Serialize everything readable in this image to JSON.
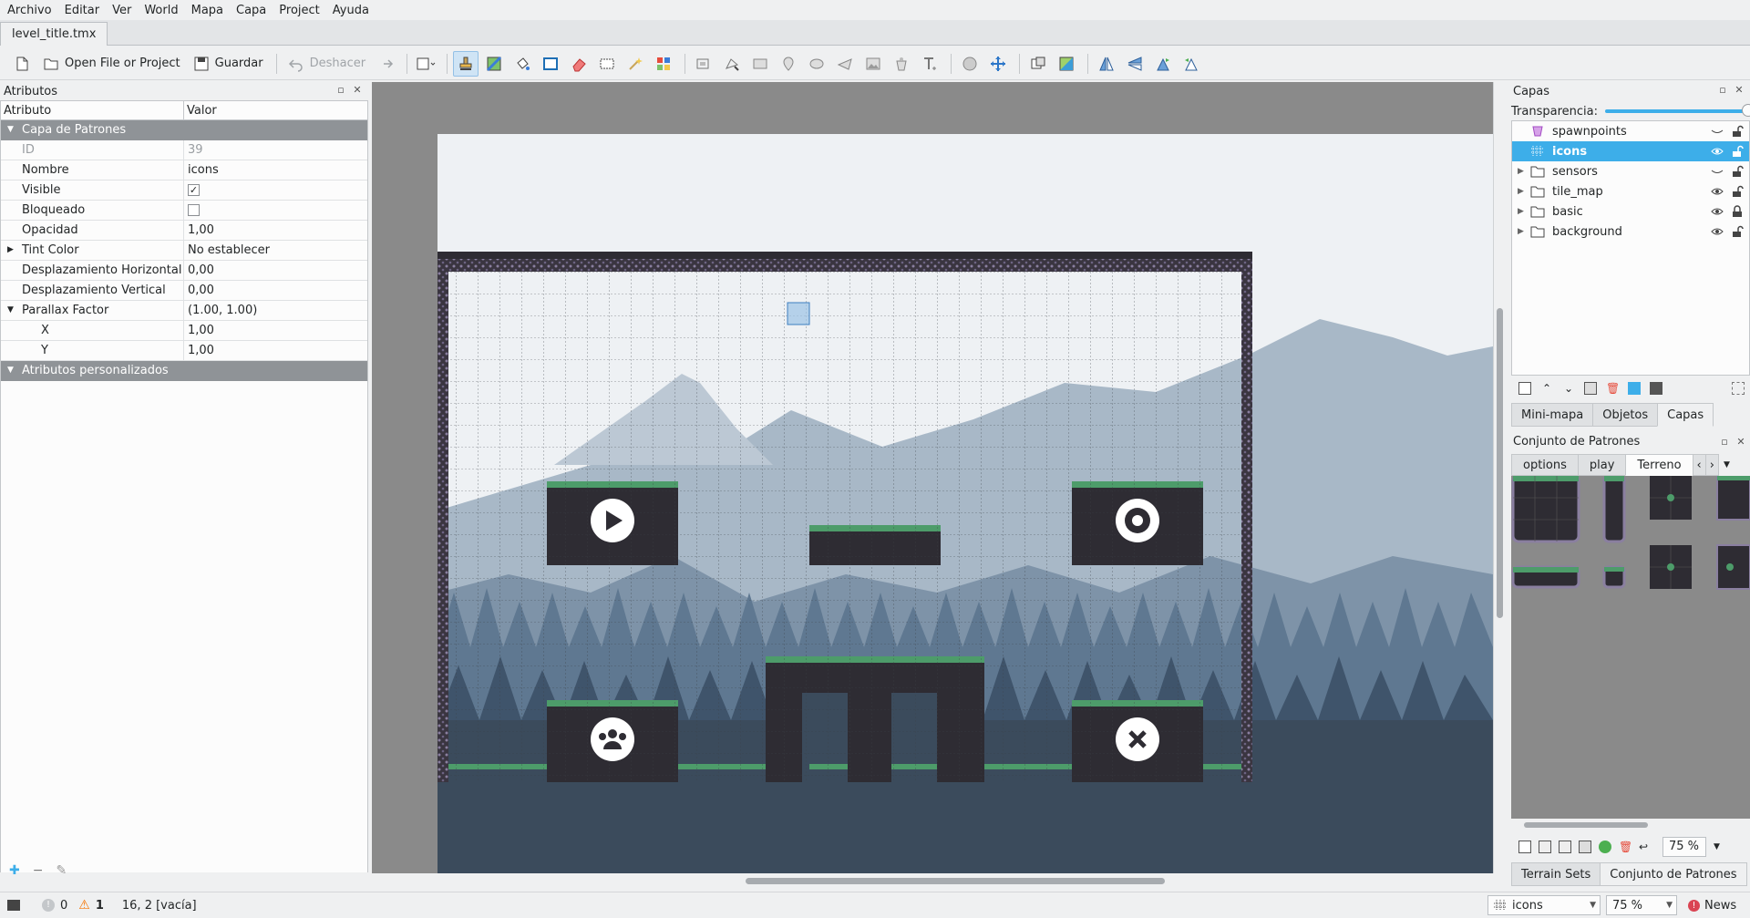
{
  "menu": [
    "Archivo",
    "Editar",
    "Ver",
    "World",
    "Mapa",
    "Capa",
    "Project",
    "Ayuda"
  ],
  "document_tab": "level_title.tmx",
  "toolbar": {
    "open_label": "Open File or Project",
    "save_label": "Guardar",
    "undo_label": "Deshacer"
  },
  "properties_panel": {
    "title": "Atributos",
    "col_attr": "Atributo",
    "col_value": "Valor",
    "group_layer": "Capa de Patrones",
    "rows": [
      {
        "k": "ID",
        "v": "39"
      },
      {
        "k": "Nombre",
        "v": "icons"
      },
      {
        "k": "Visible",
        "v": "checked"
      },
      {
        "k": "Bloqueado",
        "v": "unchecked"
      },
      {
        "k": "Opacidad",
        "v": "1,00"
      },
      {
        "k": "Tint Color",
        "v": "No establecer"
      },
      {
        "k": "Desplazamiento Horizontal",
        "v": "0,00"
      },
      {
        "k": "Desplazamiento Vertical",
        "v": "0,00"
      },
      {
        "k": "Parallax Factor",
        "v": "(1.00, 1.00)"
      },
      {
        "k": "X",
        "v": "1,00"
      },
      {
        "k": "Y",
        "v": "1,00"
      }
    ],
    "group_custom": "Atributos personalizados"
  },
  "layers_panel": {
    "title": "Capas",
    "transparency_label": "Transparencia:",
    "layers": [
      {
        "name": "spawnpoints",
        "type": "object",
        "visible": false,
        "locked": false
      },
      {
        "name": "icons",
        "type": "tile",
        "visible": true,
        "locked": false,
        "selected": true
      },
      {
        "name": "sensors",
        "type": "group",
        "visible": false,
        "locked": false
      },
      {
        "name": "tile_map",
        "type": "group",
        "visible": true,
        "locked": false
      },
      {
        "name": "basic",
        "type": "group",
        "visible": true,
        "locked": true
      },
      {
        "name": "background",
        "type": "group",
        "visible": true,
        "locked": false
      }
    ],
    "tabs": [
      "Mini-mapa",
      "Objetos",
      "Capas"
    ],
    "active_tab": "Capas"
  },
  "tileset_panel": {
    "title": "Conjunto de Patrones",
    "tabs": [
      "options",
      "play",
      "Terreno"
    ],
    "active_tab": "Terreno",
    "zoom": "75 %",
    "bottom_tabs": [
      "Terrain Sets",
      "Conjunto de Patrones"
    ],
    "active_bottom_tab": "Conjunto de Patrones"
  },
  "statusbar": {
    "errors": "0",
    "warnings": "1",
    "position": "16, 2 [vacía]",
    "layer_combo": "icons",
    "zoom": "75 %",
    "news": "News"
  },
  "colors": {
    "accent": "#3daee9",
    "sky": "#eef1f4",
    "ground": "#3b4b5c",
    "platform": "#2e2c33",
    "grass": "#4d9c6a"
  }
}
